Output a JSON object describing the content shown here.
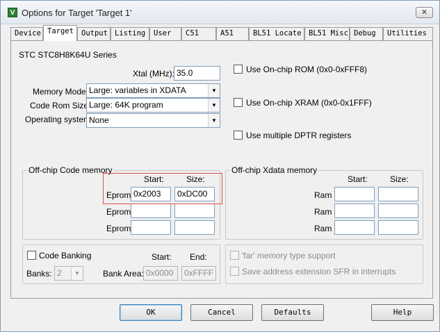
{
  "window": {
    "title": "Options for Target 'Target 1'",
    "app_icon_glyph": "V",
    "close_glyph": "✕"
  },
  "tabs": [
    {
      "label": "Device"
    },
    {
      "label": "Target"
    },
    {
      "label": "Output"
    },
    {
      "label": "Listing"
    },
    {
      "label": "User"
    },
    {
      "label": "C51"
    },
    {
      "label": "A51"
    },
    {
      "label": "BL51 Locate"
    },
    {
      "label": "BL51 Misc"
    },
    {
      "label": "Debug"
    },
    {
      "label": "Utilities"
    }
  ],
  "active_tab": "Target",
  "device_name": "STC STC8H8K64U Series",
  "xtal": {
    "label": "Xtal (MHz):",
    "value": "35.0"
  },
  "memory_model": {
    "label": "Memory Model:",
    "value": "Large: variables in XDATA"
  },
  "code_rom_size": {
    "label": "Code Rom Size:",
    "value": "Large: 64K program"
  },
  "operating_system": {
    "label": "Operating system:",
    "value": "None"
  },
  "options": {
    "on_chip_rom": {
      "label": "Use On-chip ROM (0x0-0xFFF8)",
      "checked": false
    },
    "on_chip_xram": {
      "label": "Use On-chip XRAM (0x0-0x1FFF)",
      "checked": false
    },
    "multiple_dptr": {
      "label": "Use multiple DPTR registers",
      "checked": false
    }
  },
  "offchip_code": {
    "title": "Off-chip Code memory",
    "start_header": "Start:",
    "size_header": "Size:",
    "rows": [
      {
        "label": "Eprom",
        "start": "0x2003",
        "size": "0xDC00"
      },
      {
        "label": "Eprom",
        "start": "",
        "size": ""
      },
      {
        "label": "Eprom",
        "start": "",
        "size": ""
      }
    ]
  },
  "offchip_xdata": {
    "title": "Off-chip Xdata memory",
    "start_header": "Start:",
    "size_header": "Size:",
    "rows": [
      {
        "label": "Ram",
        "start": "",
        "size": ""
      },
      {
        "label": "Ram",
        "start": "",
        "size": ""
      },
      {
        "label": "Ram",
        "start": "",
        "size": ""
      }
    ]
  },
  "code_banking": {
    "label": "Code Banking",
    "checked": false,
    "start_header": "Start:",
    "end_header": "End:",
    "banks_label": "Banks:",
    "banks_value": "2",
    "bank_area_label": "Bank Area:",
    "bank_area_start": "0x0000",
    "bank_area_end": "0xFFFF"
  },
  "far_memory": {
    "label": "'far' memory type support",
    "checked": false
  },
  "save_sfr": {
    "label": "Save address extension SFR in interrupts",
    "checked": false
  },
  "buttons": {
    "ok": "OK",
    "cancel": "Cancel",
    "defaults": "Defaults",
    "help": "Help"
  },
  "colors": {
    "highlight_box": "#e05050",
    "app_icon": "#2e7d32"
  }
}
